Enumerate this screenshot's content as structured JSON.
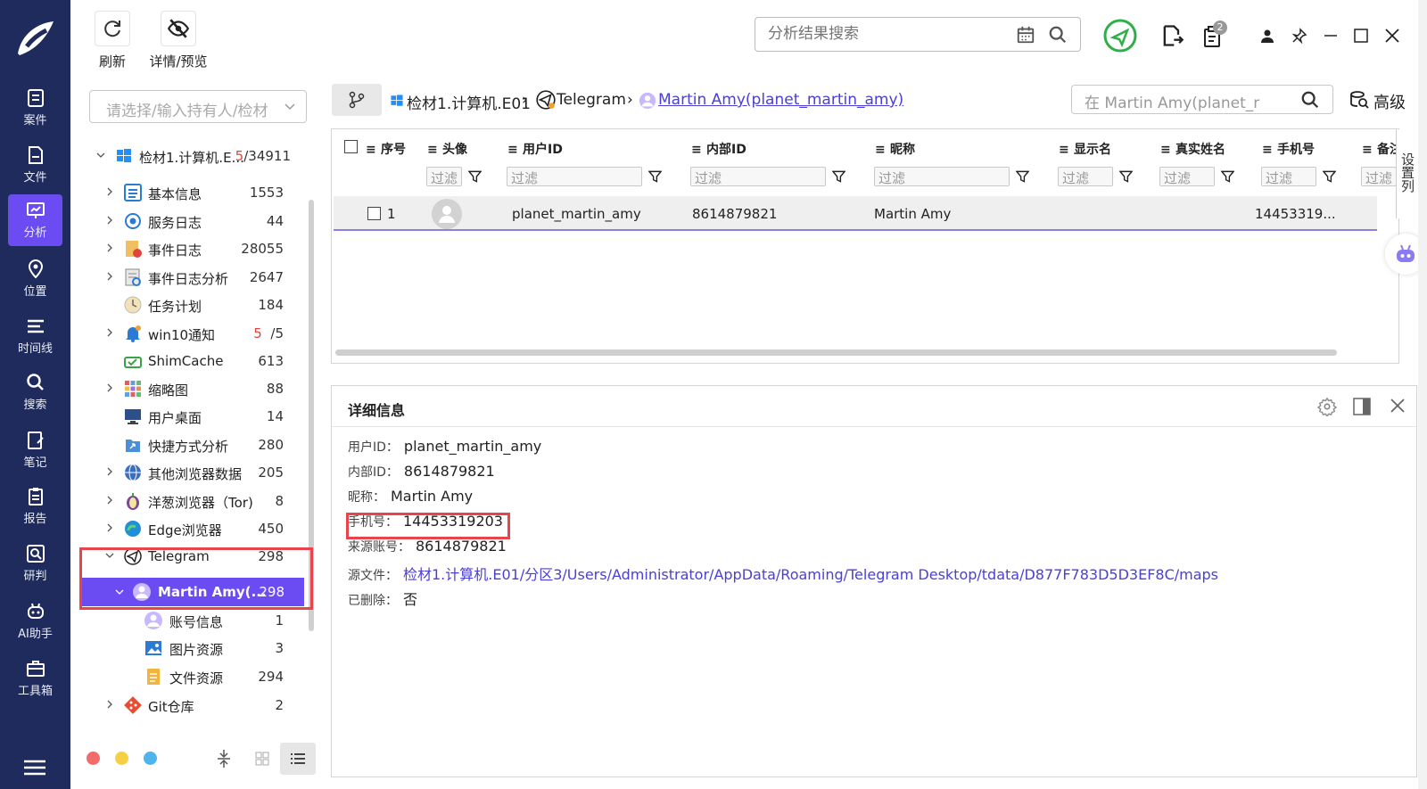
{
  "toolbar": {
    "refresh_label": "刷新",
    "details_preview_label": "详情/预览"
  },
  "global_search": {
    "placeholder": "分析结果搜索"
  },
  "notifications": {
    "badge": "2"
  },
  "nav": {
    "items": [
      {
        "label": "案件",
        "icon": "case-icon"
      },
      {
        "label": "文件",
        "icon": "file-icon"
      },
      {
        "label": "分析",
        "icon": "analysis-icon",
        "active": true
      },
      {
        "label": "位置",
        "icon": "location-icon"
      },
      {
        "label": "时间线",
        "icon": "timeline-icon"
      },
      {
        "label": "搜索",
        "icon": "search-icon"
      },
      {
        "label": "笔记",
        "icon": "notes-icon"
      },
      {
        "label": "报告",
        "icon": "report-icon"
      },
      {
        "label": "研判",
        "icon": "judge-icon"
      },
      {
        "label": "AI助手",
        "icon": "ai-assistant-icon"
      },
      {
        "label": "工具箱",
        "icon": "toolbox-icon"
      }
    ]
  },
  "owner_select": {
    "placeholder": "请选择/输入持有人/检材"
  },
  "tree": {
    "root": {
      "label": "检材1.计算机.E...",
      "count_red": "5",
      "count_rest": "/34911"
    },
    "items": [
      {
        "label": "基本信息",
        "count": "1553"
      },
      {
        "label": "服务日志",
        "count": "44"
      },
      {
        "label": "事件日志",
        "count": "28055"
      },
      {
        "label": "事件日志分析",
        "count": "2647"
      },
      {
        "label": "任务计划",
        "count": "184"
      },
      {
        "label": "win10通知",
        "count_red": "5",
        "count": "/5"
      },
      {
        "label": "ShimCache",
        "count": "613"
      },
      {
        "label": "缩略图",
        "count": "88"
      },
      {
        "label": "用户桌面",
        "count": "14"
      },
      {
        "label": "快捷方式分析",
        "count": "280"
      },
      {
        "label": "其他浏览器数据",
        "count": "205"
      },
      {
        "label": "洋葱浏览器（Tor)",
        "count": "8"
      },
      {
        "label": "Edge浏览器",
        "count": "450"
      },
      {
        "label": "Telegram",
        "count": "298"
      },
      {
        "label": "Martin Amy(...",
        "count": "298"
      },
      {
        "label": "账号信息",
        "count": "1"
      },
      {
        "label": "图片资源",
        "count": "3"
      },
      {
        "label": "文件资源",
        "count": "294"
      },
      {
        "label": "Git仓库",
        "count": "2"
      }
    ]
  },
  "breadcrumb": {
    "items": [
      "检材1.计算机.E01",
      "Telegram",
      "Martin Amy(planet_martin_amy)"
    ]
  },
  "table_search": {
    "placeholder": "在 Martin Amy(planet_r"
  },
  "advanced_label": "高级",
  "table": {
    "columns": [
      "序号",
      "头像",
      "用户ID",
      "内部ID",
      "昵称",
      "显示名",
      "真实姓名",
      "手机号",
      "备注"
    ],
    "filter_placeholder": "过滤",
    "rows": [
      {
        "index": "1",
        "user_id": "planet_martin_amy",
        "internal_id": "8614879821",
        "nickname": "Martin Amy",
        "display_name": "",
        "real_name": "",
        "phone": "14453319..."
      }
    ],
    "column_settings_label": "设置列"
  },
  "details": {
    "title": "详细信息",
    "fields": [
      {
        "label": "用户ID：",
        "value": "planet_martin_amy"
      },
      {
        "label": "内部ID：",
        "value": "8614879821"
      },
      {
        "label": "昵称：",
        "value": "Martin Amy"
      },
      {
        "label": "手机号：",
        "value": "14453319203"
      },
      {
        "label": "来源账号：",
        "value": "8614879821"
      },
      {
        "label": "源文件：",
        "value": "检材1.计算机.E01/分区3/Users/Administrator/AppData/Roaming/Telegram Desktop/tdata/D877F783D5D3EF8C/maps"
      },
      {
        "label": "已删除：",
        "value": "否"
      }
    ]
  },
  "colors": {
    "nav_bg": "#1f2b5c",
    "accent": "#6a4cf2",
    "highlight": "#e8444c",
    "link": "#4a3fd6"
  }
}
